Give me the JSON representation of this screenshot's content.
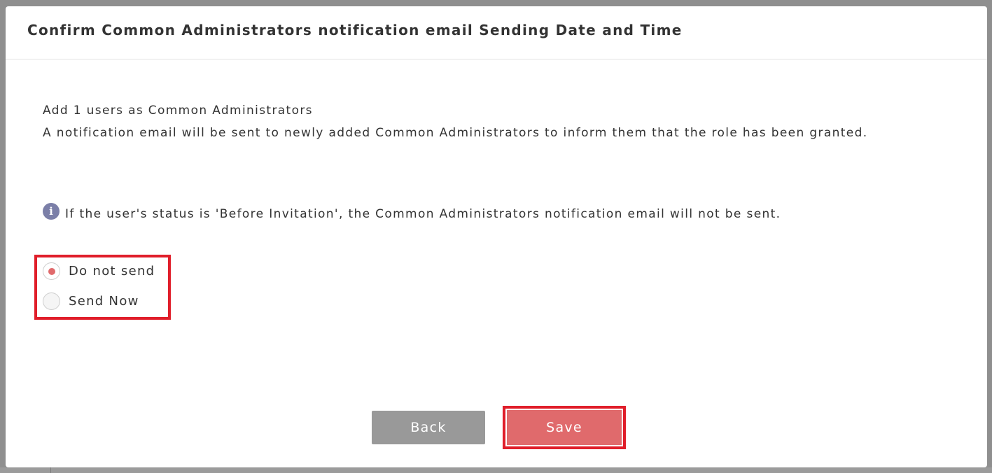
{
  "dialog": {
    "title": "Confirm Common Administrators notification email Sending Date and Time",
    "message_line1": "Add 1 users as Common Administrators",
    "message_line2": "A notification email will be sent to newly added Common Administrators to inform them that the role has been granted.",
    "info_note": "If the user's status is 'Before Invitation', the Common Administrators notification email will not be sent.",
    "info_icon_glyph": "i",
    "radio_options": [
      {
        "label": "Do not send",
        "selected": true
      },
      {
        "label": "Send Now",
        "selected": false
      }
    ],
    "back_label": "Back",
    "save_label": "Save"
  },
  "colors": {
    "accent": "#e06a6c",
    "highlight_box": "#e01e2a",
    "secondary_button": "#999999",
    "info_icon": "#7b7fa8",
    "overlay": "#8f8f8f"
  }
}
